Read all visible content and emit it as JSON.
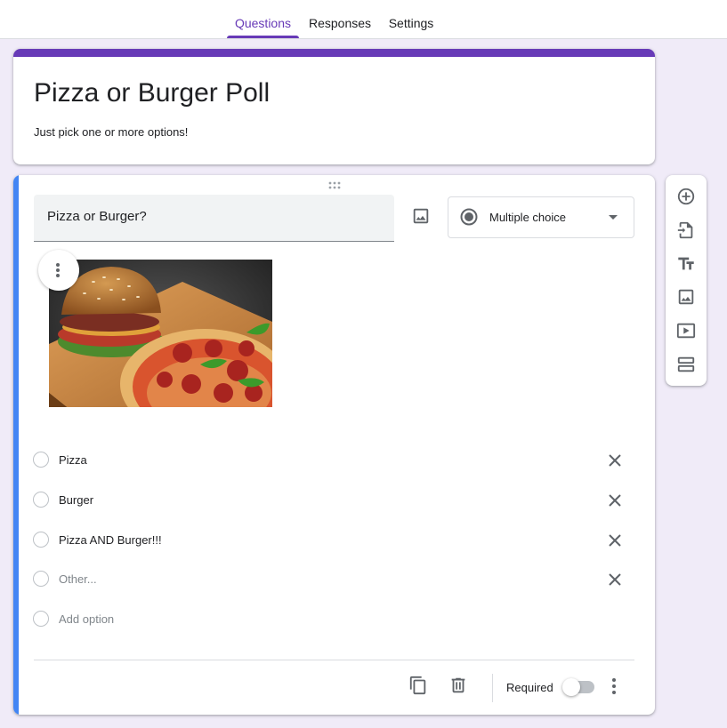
{
  "tabs": [
    {
      "label": "Questions",
      "active": true
    },
    {
      "label": "Responses",
      "active": false
    },
    {
      "label": "Settings",
      "active": false
    }
  ],
  "form": {
    "title": "Pizza or Burger Poll",
    "description": "Just pick one or more options!",
    "accent_color": "#673ab7"
  },
  "question": {
    "title": "Pizza or Burger?",
    "type_label": "Multiple choice",
    "image_icon": "image-icon",
    "options": [
      {
        "label": "Pizza"
      },
      {
        "label": "Burger"
      },
      {
        "label": "Pizza AND Burger!!!"
      },
      {
        "label": "Other..."
      }
    ],
    "add_option_label": "Add option",
    "required_label": "Required",
    "required": false,
    "active_bar_color": "#4285f4"
  },
  "sidebar_icons": [
    "add-question-icon",
    "import-questions-icon",
    "add-title-icon",
    "add-image-icon",
    "add-video-icon",
    "add-section-icon"
  ],
  "footer_icons": [
    "duplicate-icon",
    "delete-icon",
    "more-options-icon"
  ]
}
